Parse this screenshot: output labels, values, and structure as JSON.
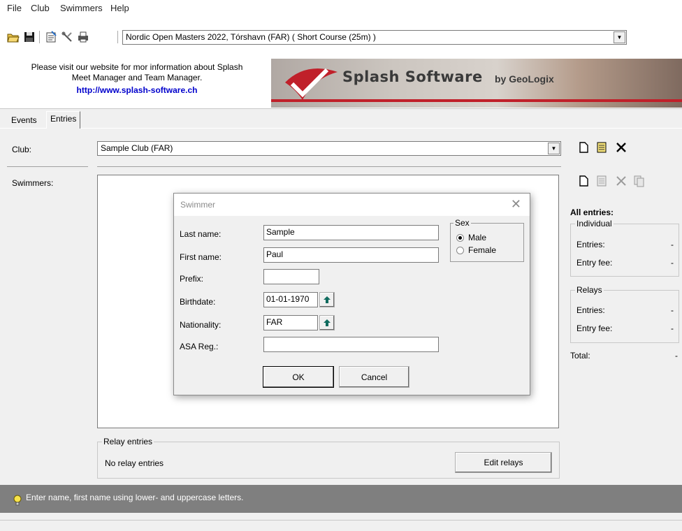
{
  "menu": {
    "file": "File",
    "club": "Club",
    "swimmers": "Swimmers",
    "help": "Help"
  },
  "toolbar": {
    "icons": [
      "open-folder-icon",
      "save-disk-icon",
      "properties-icon",
      "tools-icon",
      "print-icon"
    ],
    "meet_value": "Nordic Open Masters 2022,  Tórshavn  (FAR)   ( Short Course (25m) )"
  },
  "banner": {
    "text_line1": "Please visit our website for mor information about Splash",
    "text_line2": "Meet Manager and Team Manager.",
    "url": "http://www.splash-software.ch",
    "logo_title": "Splash Software",
    "logo_sub": "by GeoLogix"
  },
  "tabs": {
    "events": "Events",
    "entries": "Entries"
  },
  "club": {
    "label": "Club:",
    "value": "Sample Club (FAR)"
  },
  "swimmers": {
    "label": "Swimmers:"
  },
  "relay": {
    "title": "Relay entries",
    "status": "No relay entries",
    "edit_button": "Edit relays"
  },
  "right_panel": {
    "all_entries_title": "All entries:",
    "individual_title": "Individual",
    "individual_entries_label": "Entries:",
    "individual_entries_value": "-",
    "individual_fee_label": "Entry fee:",
    "individual_fee_value": "-",
    "relays_title": "Relays",
    "relays_entries_label": "Entries:",
    "relays_entries_value": "-",
    "relays_fee_label": "Entry fee:",
    "relays_fee_value": "-",
    "total_label": "Total:",
    "total_value": "-"
  },
  "status": {
    "hint": "Enter name, first name using lower- and uppercase letters."
  },
  "dialog": {
    "title": "Swimmer",
    "last_name_label": "Last name:",
    "last_name_value": "Sample",
    "first_name_label": "First name:",
    "first_name_value": "Paul",
    "prefix_label": "Prefix:",
    "prefix_value": "",
    "birthdate_label": "Birthdate:",
    "birthdate_value": "01-01-1970",
    "nationality_label": "Nationality:",
    "nationality_value": "FAR",
    "asa_label": "ASA Reg.:",
    "asa_value": "",
    "sex_title": "Sex",
    "sex_male": "Male",
    "sex_female": "Female",
    "sex_selected": "Male",
    "ok": "OK",
    "cancel": "Cancel"
  },
  "colors": {
    "accent_url": "#0000cc",
    "status_bar": "#7f7f7f",
    "spin_arrow": "#0f6b5e"
  }
}
